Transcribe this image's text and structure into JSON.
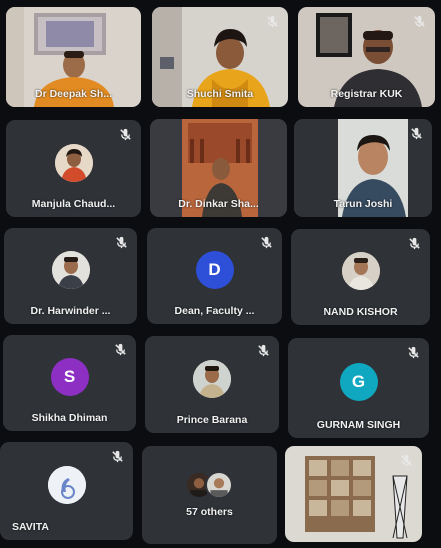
{
  "colors": {
    "background": "#0b0d10",
    "tile": "#2f3338",
    "name_text": "#f1f1f1",
    "avatar_d": "#2e4fd8",
    "avatar_s": "#8e2fc4",
    "avatar_g": "#10a8c0"
  },
  "participants": [
    {
      "id": "p1",
      "name": "Dr Deepak Sh...",
      "type": "video",
      "muted": false
    },
    {
      "id": "p2",
      "name": "Shuchi Smita",
      "type": "video",
      "muted": true
    },
    {
      "id": "p3",
      "name": "Registrar KUK",
      "type": "video",
      "muted": true
    },
    {
      "id": "p4",
      "name": "Manjula Chaud...",
      "type": "photo",
      "muted": true
    },
    {
      "id": "p5",
      "name": "Dr. Dinkar Sha...",
      "type": "video",
      "muted": false
    },
    {
      "id": "p6",
      "name": "Tarun Joshi",
      "type": "video",
      "muted": true
    },
    {
      "id": "p7",
      "name": "Dr. Harwinder ...",
      "type": "photo",
      "muted": true
    },
    {
      "id": "p8",
      "name": "Dean, Faculty ...",
      "type": "letter",
      "letter": "D",
      "muted": true
    },
    {
      "id": "p9",
      "name": "NAND KISHOR",
      "type": "photo",
      "muted": true
    },
    {
      "id": "p10",
      "name": "Shikha Dhiman",
      "type": "letter",
      "letter": "S",
      "muted": true
    },
    {
      "id": "p11",
      "name": "Prince Barana",
      "type": "photo",
      "muted": true
    },
    {
      "id": "p12",
      "name": "GURNAM SINGH",
      "type": "letter",
      "letter": "G",
      "muted": true
    },
    {
      "id": "p13",
      "name": "SAVITA",
      "type": "photo",
      "muted": true
    },
    {
      "id": "p14",
      "name": "57 others",
      "type": "others",
      "muted": false
    },
    {
      "id": "p15",
      "name": "",
      "type": "video",
      "muted": true
    }
  ]
}
